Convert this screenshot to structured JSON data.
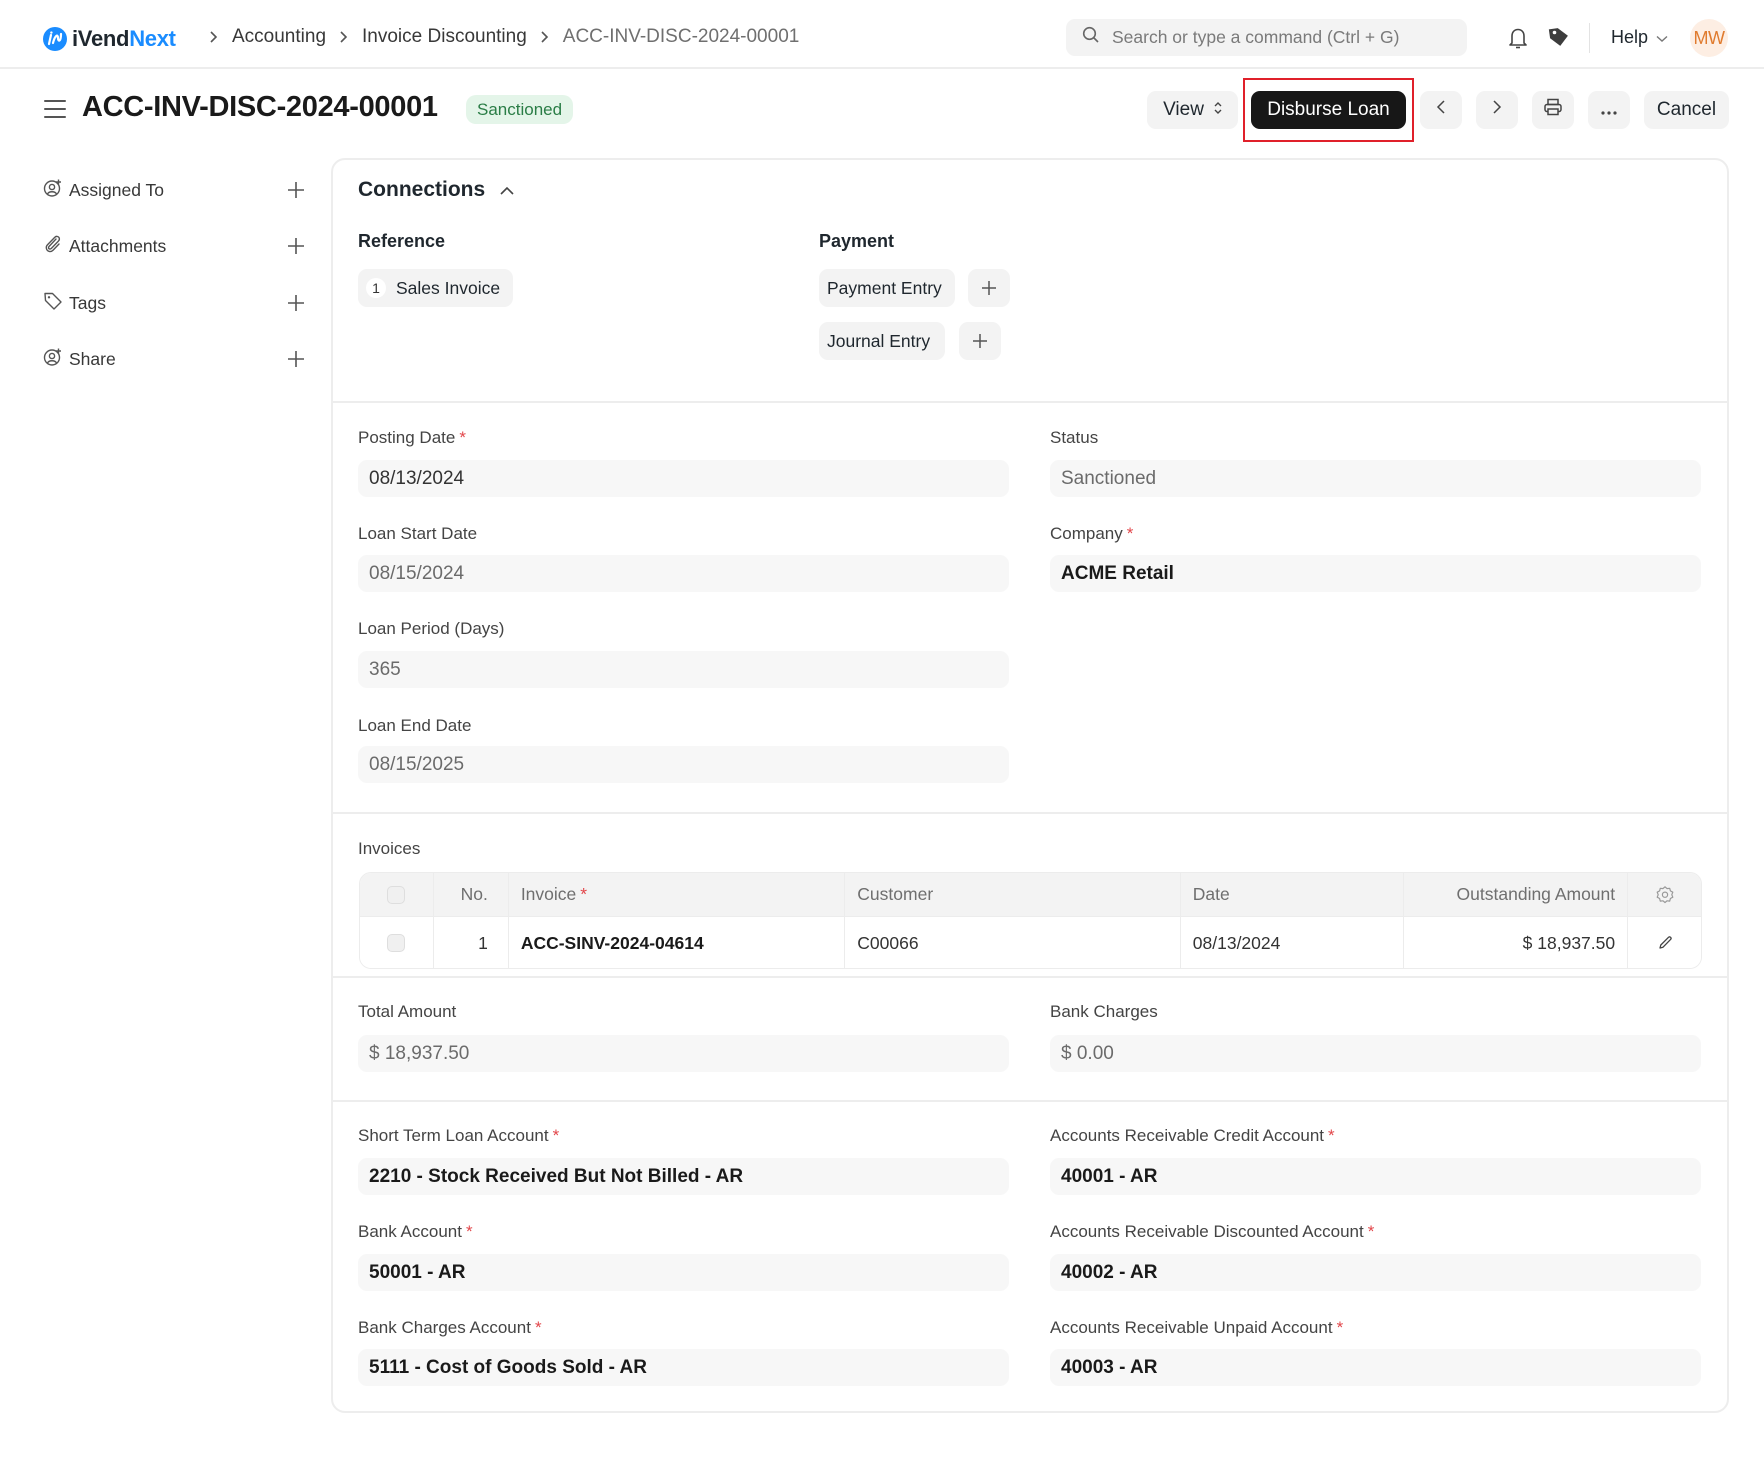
{
  "app": {
    "brand_prefix": "iVend",
    "brand_suffix": "Next",
    "brand_color": "#1a8cff"
  },
  "breadcrumb": [
    "Accounting",
    "Invoice Discounting",
    "ACC-INV-DISC-2024-00001"
  ],
  "search": {
    "placeholder": "Search or type a command (Ctrl + G)",
    "value": ""
  },
  "navbar": {
    "help_label": "Help",
    "avatar_initials": "MW",
    "icons": [
      "bell-icon",
      "tag-icon"
    ]
  },
  "header": {
    "title": "ACC-INV-DISC-2024-00001",
    "status": "Sanctioned",
    "status_color": "#2a7d46",
    "buttons": {
      "view": "View",
      "primary": "Disburse Loan",
      "cancel": "Cancel"
    },
    "primary_color": "#171717",
    "highlight_color": "#e0202a"
  },
  "sidebar": {
    "items": [
      {
        "label": "Assigned To",
        "icon": "user-add-icon"
      },
      {
        "label": "Attachments",
        "icon": "paperclip-icon"
      },
      {
        "label": "Tags",
        "icon": "tag-outline-icon"
      },
      {
        "label": "Share",
        "icon": "share-user-icon"
      }
    ]
  },
  "connections": {
    "title": "Connections",
    "groups": [
      {
        "label": "Reference",
        "items": [
          {
            "label": "Sales Invoice",
            "count": "1"
          }
        ]
      },
      {
        "label": "Payment",
        "items": [
          {
            "label": "Payment Entry"
          },
          {
            "label": "Journal Entry"
          }
        ]
      }
    ]
  },
  "fields": {
    "posting_date": {
      "label": "Posting Date",
      "value": "08/13/2024",
      "required": true
    },
    "loan_start_date": {
      "label": "Loan Start Date",
      "value": "08/15/2024"
    },
    "loan_period": {
      "label": "Loan Period (Days)",
      "value": "365"
    },
    "loan_end_date": {
      "label": "Loan End Date",
      "value": "08/15/2025"
    },
    "status": {
      "label": "Status",
      "value": "Sanctioned"
    },
    "company": {
      "label": "Company",
      "value": "ACME Retail",
      "required": true
    }
  },
  "invoices": {
    "label": "Invoices",
    "columns": [
      "No.",
      "Invoice",
      "Customer",
      "Date",
      "Outstanding Amount"
    ],
    "rows": [
      {
        "no": "1",
        "invoice": "ACC-SINV-2024-04614",
        "customer": "C00066",
        "date": "08/13/2024",
        "outstanding": "$ 18,937.50"
      }
    ]
  },
  "totals": {
    "total_amount": {
      "label": "Total Amount",
      "value": "$ 18,937.50"
    },
    "bank_charges": {
      "label": "Bank Charges",
      "value": "$ 0.00"
    }
  },
  "accounts": {
    "short_term_loan": {
      "label": "Short Term Loan Account",
      "value": "2210 - Stock Received But Not Billed - AR"
    },
    "bank_account": {
      "label": "Bank Account",
      "value": "50001 - AR"
    },
    "bank_charges_account": {
      "label": "Bank Charges Account",
      "value": "5111 - Cost of Goods Sold - AR"
    },
    "ar_credit": {
      "label": "Accounts Receivable Credit Account",
      "value": "40001 - AR"
    },
    "ar_discounted": {
      "label": "Accounts Receivable Discounted Account",
      "value": "40002 - AR"
    },
    "ar_unpaid": {
      "label": "Accounts Receivable Unpaid Account",
      "value": "40003 - AR"
    }
  }
}
